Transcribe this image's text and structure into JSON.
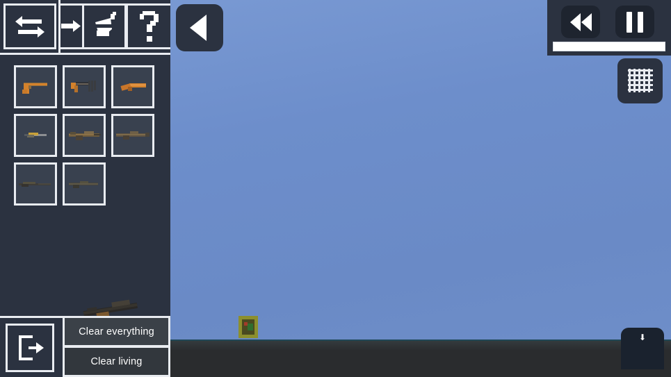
{
  "app": {
    "title": "Sandbox Weapon Spawn Menu",
    "background_sky_color": "#6d8ecb",
    "ground_color": "#2a2c2e",
    "panel_color": "#2b3240",
    "outline_color": "#e9ecf1"
  },
  "world": {
    "entity_label": "spawned-entity",
    "entity_colors": {
      "body": "#8c8f2e",
      "inner": "#4a4a20",
      "accent_red": "#a33b2a",
      "accent_green": "#2f6e2f"
    }
  },
  "back_button": {
    "icon": "triangle-left-icon",
    "label": ""
  },
  "transport": {
    "rewind": {
      "icon": "rewind-icon",
      "label": ""
    },
    "pause": {
      "icon": "pause-icon",
      "label": ""
    },
    "speed_bar": {
      "name": "time-speed-bar",
      "fill_percent": 100,
      "fill_color": "#ffffff"
    }
  },
  "grid_button": {
    "icon": "grid-icon",
    "label": ""
  },
  "download_button": {
    "icon": "download-icon",
    "label": ""
  },
  "toolbar": {
    "items": [
      {
        "name": "swap-tool",
        "icon": "swap-arrows-icon",
        "label": ""
      },
      {
        "name": "arrow-tool",
        "icon": "arrow-right-icon",
        "label": ""
      },
      {
        "name": "paint-tool",
        "icon": "paint-bucket-icon",
        "label": ""
      },
      {
        "name": "help-tool",
        "icon": "question-mark-icon",
        "label": "?"
      }
    ]
  },
  "inventory": {
    "columns": 3,
    "slots": [
      {
        "index": 0,
        "name": "pistol",
        "type": "handgun",
        "tint": "#c97a2a"
      },
      {
        "index": 1,
        "name": "machine-pistol",
        "type": "smg",
        "tint": "#c97a2a"
      },
      {
        "index": 2,
        "name": "sawed-off-shotgun",
        "type": "shotgun",
        "tint": "#d4822c"
      },
      {
        "index": 3,
        "name": "submachine-gun",
        "type": "smg",
        "tint": "#b6933f"
      },
      {
        "index": 4,
        "name": "assault-rifle",
        "type": "rifle",
        "tint": "#8a7046"
      },
      {
        "index": 5,
        "name": "battle-rifle",
        "type": "rifle",
        "tint": "#7d6a4a"
      },
      {
        "index": 6,
        "name": "sniper-rifle",
        "type": "sniper",
        "tint": "#4a4740"
      },
      {
        "index": 7,
        "name": "marksman-rifle",
        "type": "sniper",
        "tint": "#55503f"
      }
    ]
  },
  "bottom_panel": {
    "exit_button": {
      "icon": "exit-door-icon",
      "label": ""
    },
    "clear_everything_label": "Clear everything",
    "clear_living_label": "Clear living"
  },
  "drag_preview": {
    "name": "dragged-weapon-preview",
    "visible": true
  }
}
